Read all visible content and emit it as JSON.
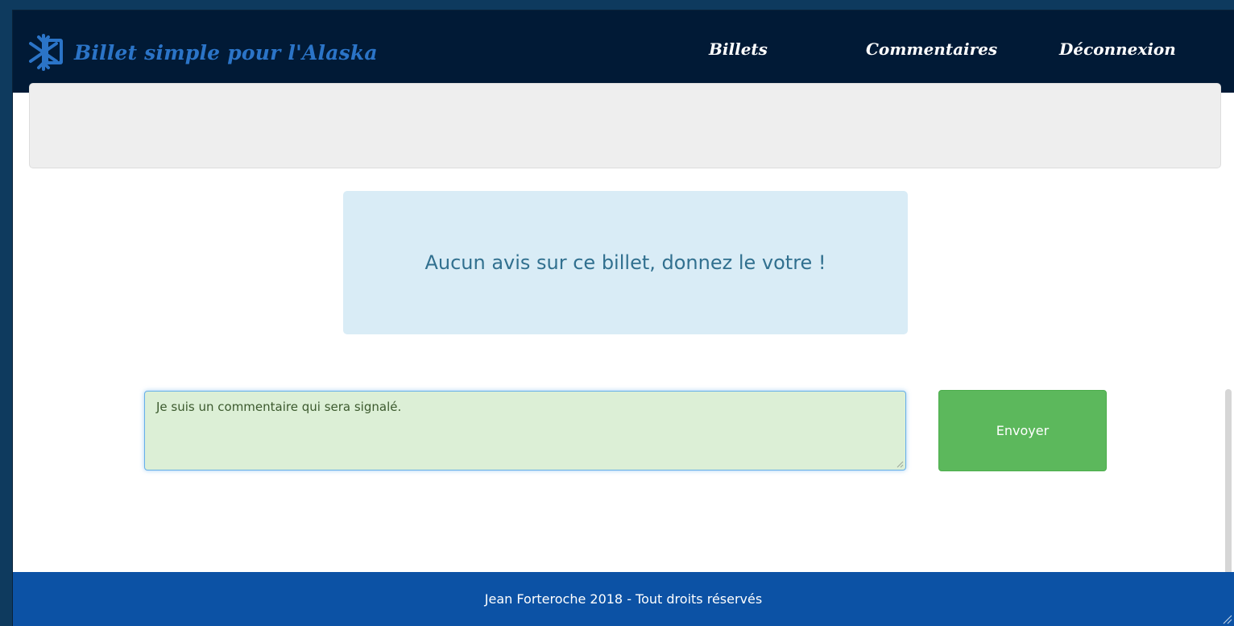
{
  "header": {
    "brand": "Billet simple pour l'Alaska",
    "nav": {
      "billets": "Billets",
      "commentaires": "Commentaires",
      "deconnexion": "Déconnexion"
    }
  },
  "info": {
    "message": "Aucun avis sur ce billet, donnez le votre !"
  },
  "comment_form": {
    "value": "Je suis un commentaire qui sera signalé.",
    "submit_label": "Envoyer"
  },
  "footer": {
    "text": "Jean Forteroche 2018 - Tout droits réservés"
  },
  "colors": {
    "navbar": "#011a36",
    "brand": "#2b74c7",
    "info_bg": "#d9ecf6",
    "info_text": "#31708f",
    "input_bg": "#dcefd6",
    "button": "#5cb85c",
    "footer": "#0c52a5"
  },
  "icons": {
    "brand_logo": "snowflake-book-icon"
  }
}
